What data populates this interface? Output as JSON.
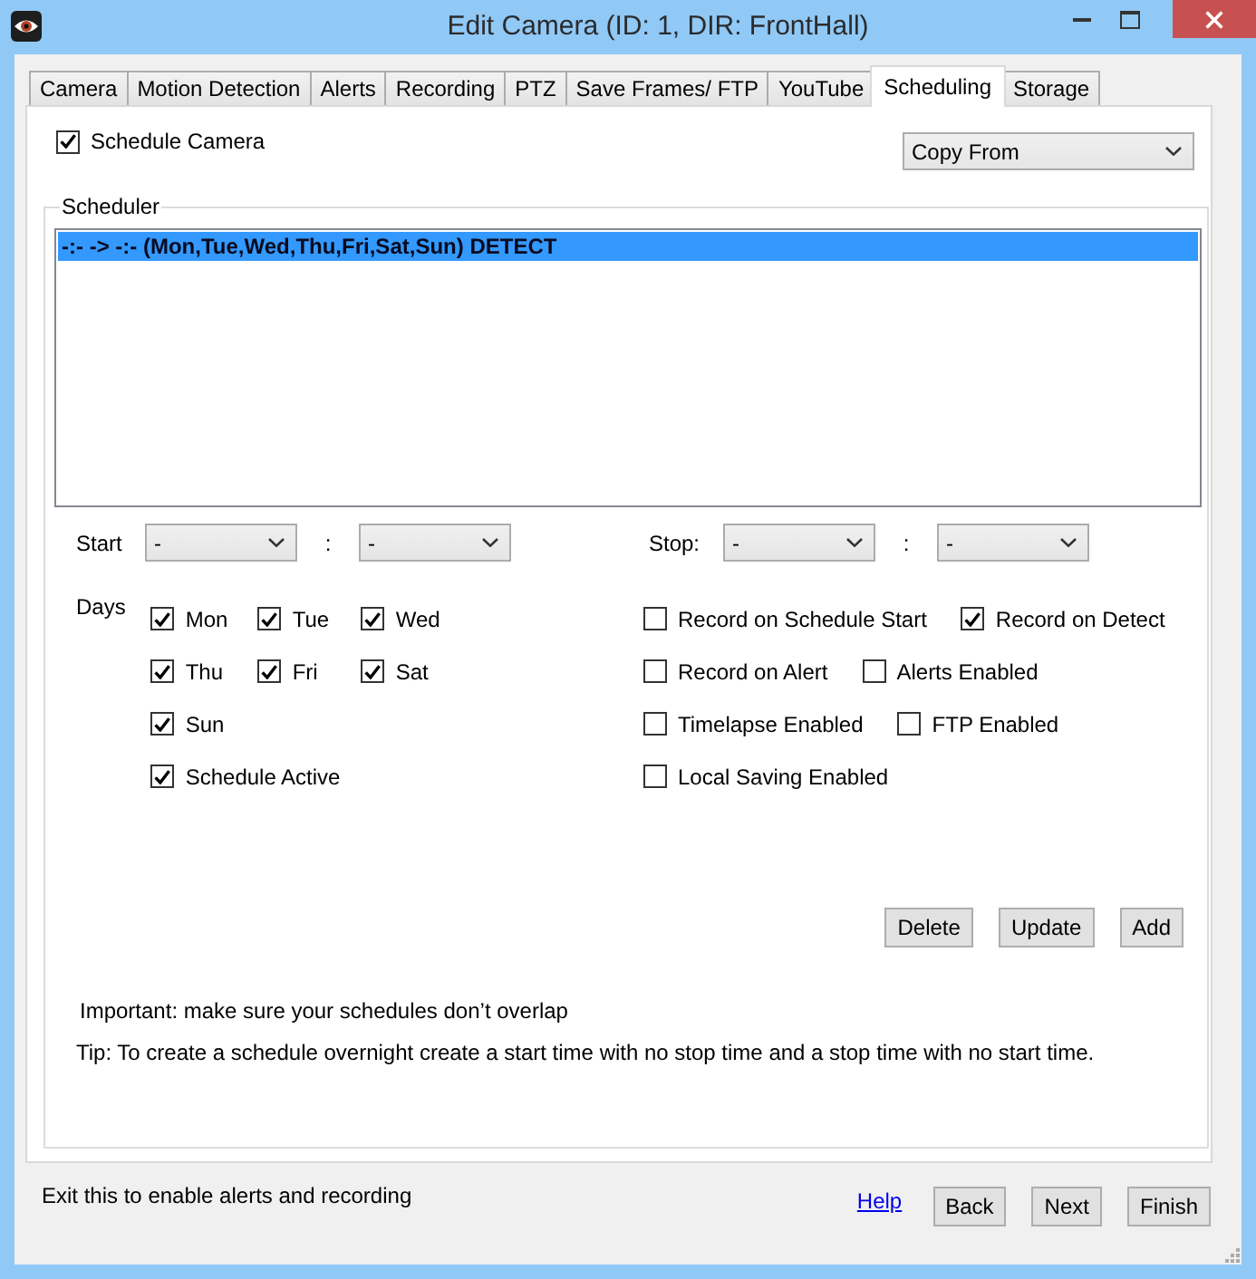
{
  "window": {
    "title": "Edit Camera (ID: 1, DIR: FrontHall)"
  },
  "tabs": [
    {
      "label": "Camera",
      "selected": false
    },
    {
      "label": "Motion Detection",
      "selected": false
    },
    {
      "label": "Alerts",
      "selected": false
    },
    {
      "label": "Recording",
      "selected": false
    },
    {
      "label": "PTZ",
      "selected": false
    },
    {
      "label": "Save Frames/ FTP",
      "selected": false
    },
    {
      "label": "YouTube",
      "selected": false
    },
    {
      "label": "Scheduling",
      "selected": true
    },
    {
      "label": "Storage",
      "selected": false
    }
  ],
  "schedule_camera": {
    "label": "Schedule Camera",
    "checked": true
  },
  "copy_from": {
    "value": "Copy From"
  },
  "scheduler": {
    "title": "Scheduler",
    "entries": [
      {
        "text": "-:- -> -:- (Mon,Tue,Wed,Thu,Fri,Sat,Sun) DETECT",
        "selected": true
      }
    ],
    "start": {
      "label": "Start",
      "hour": "-",
      "separator": ":",
      "minute": "-"
    },
    "stop": {
      "label": "Stop:",
      "hour": "-",
      "separator": ":",
      "minute": "-"
    },
    "days_label": "Days",
    "days": [
      {
        "label": "Mon",
        "checked": true
      },
      {
        "label": "Tue",
        "checked": true
      },
      {
        "label": "Wed",
        "checked": true
      },
      {
        "label": "Thu",
        "checked": true
      },
      {
        "label": "Fri",
        "checked": true
      },
      {
        "label": "Sat",
        "checked": true
      },
      {
        "label": "Sun",
        "checked": true
      }
    ],
    "schedule_active": {
      "label": "Schedule Active",
      "checked": true
    },
    "option_rows": [
      [
        {
          "label": "Record on Schedule Start",
          "checked": false
        },
        {
          "label": "Record on Detect",
          "checked": true
        }
      ],
      [
        {
          "label": "Record on Alert",
          "checked": false
        },
        {
          "label": "Alerts Enabled",
          "checked": false
        }
      ],
      [
        {
          "label": "Timelapse Enabled",
          "checked": false
        },
        {
          "label": "FTP Enabled",
          "checked": false
        }
      ],
      [
        {
          "label": "Local Saving Enabled",
          "checked": false
        }
      ]
    ],
    "buttons": [
      {
        "label": "Delete"
      },
      {
        "label": "Update"
      },
      {
        "label": "Add"
      }
    ],
    "notes": [
      "Important: make sure your schedules don’t overlap",
      "Tip: To create a schedule overnight create a start time with no stop time and a stop time with no start time."
    ]
  },
  "footer": {
    "hint": "Exit this to enable alerts and recording",
    "help_link": "Help",
    "buttons": [
      "Back",
      "Next",
      "Finish"
    ]
  }
}
